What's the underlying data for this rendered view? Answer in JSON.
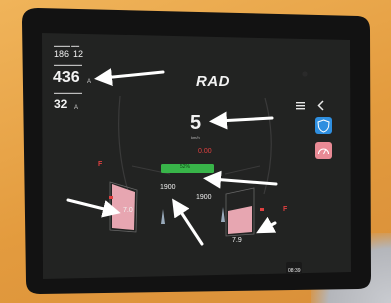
{
  "left_panel": {
    "values_top": [
      "186",
      "12"
    ],
    "big_value": "436",
    "big_unit": "A",
    "second_value": "32",
    "second_unit": "A"
  },
  "brand": {
    "logo": "RAD"
  },
  "center": {
    "gear": "5",
    "gear_label": "km/h",
    "red_value": "0.00",
    "green_bar_label": "52%"
  },
  "gauges": {
    "left_rpm": "1900",
    "right_rpm": "1900",
    "left_pressure": "7.0",
    "right_pressure": "7.9",
    "left_flag": "F",
    "right_flag": "F"
  },
  "clock": {
    "time": "08:39"
  },
  "icons": [
    "menu-icon",
    "back-icon",
    "shield-icon",
    "speedometer-icon"
  ],
  "colors": {
    "bezel": "#121212",
    "screen": "#232323",
    "accent_blue": "#2f8fe0",
    "accent_pink": "#e98a95",
    "green": "#38b449",
    "gauge_pink": "#e7a6b1",
    "red": "#e04040"
  }
}
